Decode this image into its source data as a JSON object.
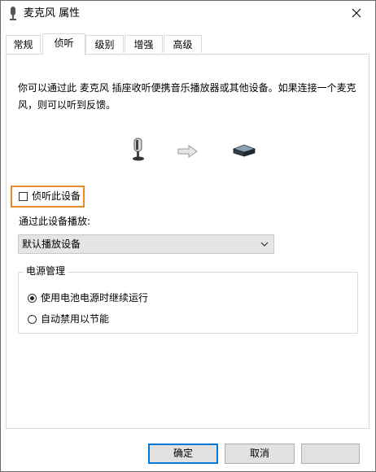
{
  "window": {
    "title": "麦克风 属性"
  },
  "tabs": [
    {
      "label": "常规"
    },
    {
      "label": "侦听"
    },
    {
      "label": "级别"
    },
    {
      "label": "增强"
    },
    {
      "label": "高级"
    }
  ],
  "active_tab": "侦听",
  "listen": {
    "description": "你可以通过此 麦克风 插座收听便携音乐播放器或其他设备。如果连接一个麦克风，则可以听到反馈。",
    "listen_checkbox_label": "侦听此设备",
    "listen_checked": false,
    "playback_label": "通过此设备播放:",
    "playback_selected": "默认播放设备"
  },
  "power": {
    "title": "电源管理",
    "options": [
      {
        "label": "使用电池电源时继续运行",
        "selected": true
      },
      {
        "label": "自动禁用以节能",
        "selected": false
      }
    ]
  },
  "buttons": {
    "ok": "确定",
    "cancel": "取消"
  },
  "colors": {
    "highlight": "#e8892b",
    "accent": "#0078d7"
  }
}
